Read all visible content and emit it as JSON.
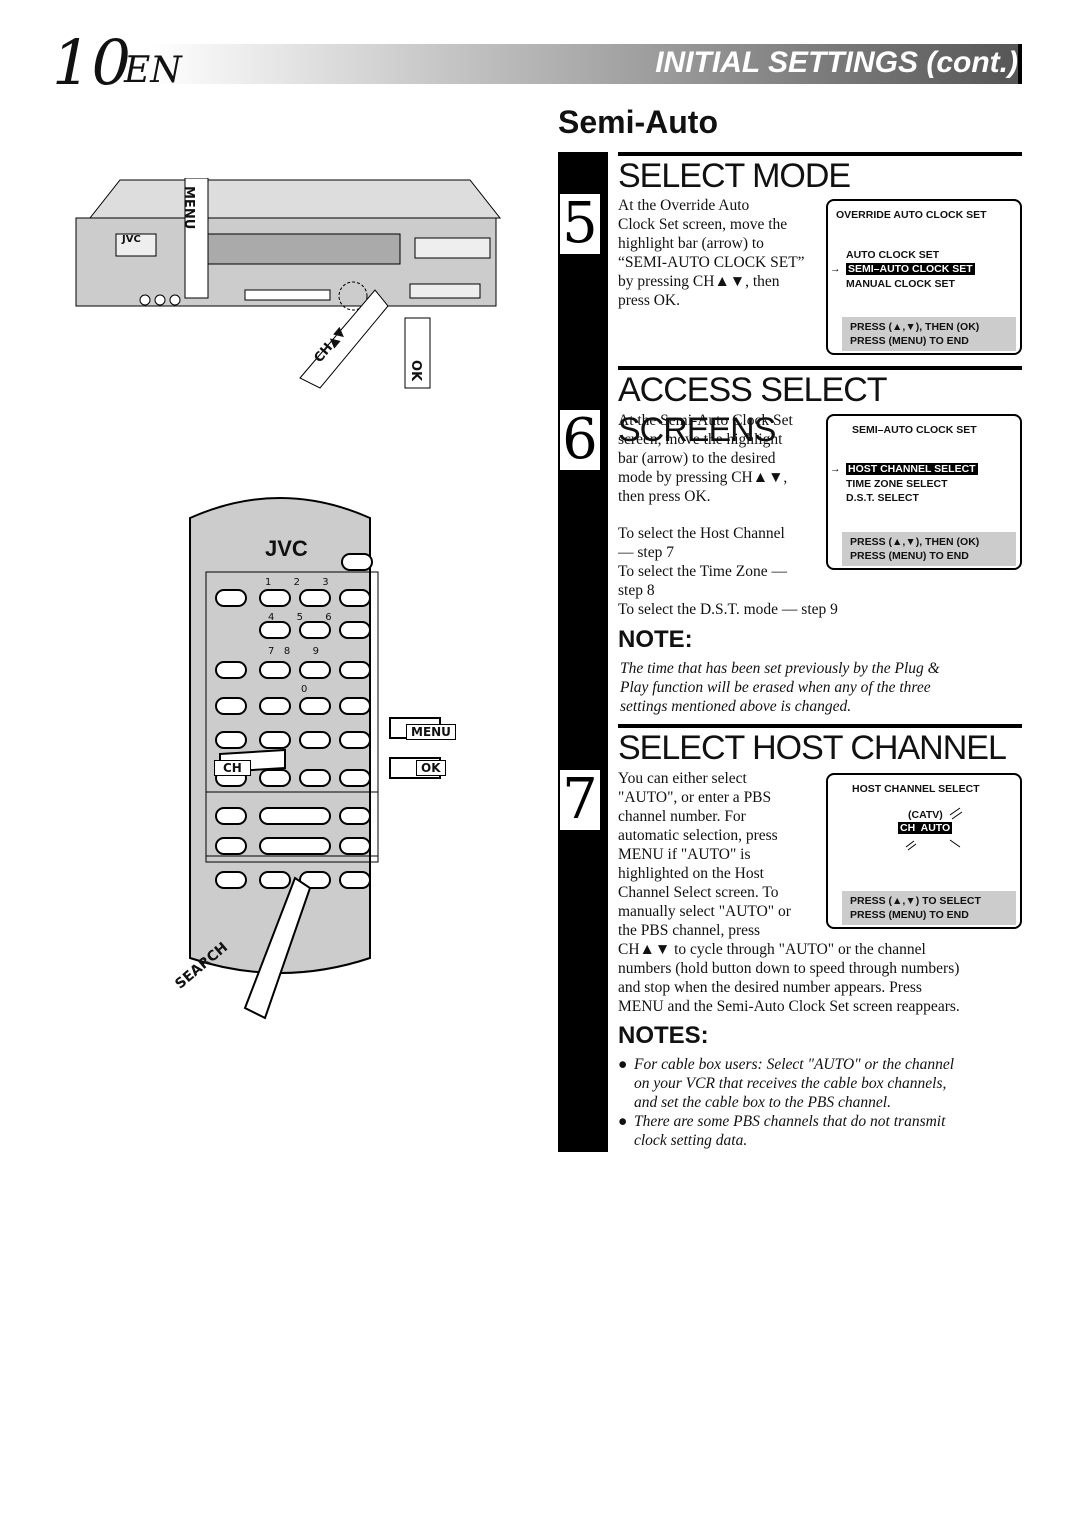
{
  "header": {
    "page_number": "10",
    "lang": "EN",
    "title": "INITIAL SETTINGS (cont.)"
  },
  "section": "Semi-Auto",
  "illustration": {
    "vcr_brand": "JVC",
    "menu_label": "MENU",
    "ch_label": "CH▲▼",
    "ok_label": "OK",
    "remote_brand": "JVC",
    "keys": [
      "1",
      "2",
      "3",
      "4",
      "5",
      "6",
      "7",
      "8",
      "9",
      "0"
    ],
    "remote_menu": "MENU",
    "remote_ch": "CH",
    "remote_ok": "OK",
    "search": "SEARCH"
  },
  "steps": [
    {
      "num": "5",
      "title": "SELECT MODE",
      "text": [
        "At the Override Auto",
        "Clock Set screen, move the",
        "highlight bar (arrow) to",
        "“SEMI-AUTO CLOCK SET”",
        "by pressing CH▲▼, then",
        "press OK."
      ],
      "osd": {
        "title": "OVERRIDE AUTO CLOCK SET",
        "items": [
          "AUTO CLOCK SET",
          "SEMI–AUTO CLOCK SET",
          "MANUAL CLOCK SET"
        ],
        "selected": 1,
        "press1": "PRESS (▲,▼), THEN (OK)",
        "press2": "PRESS (MENU) TO END"
      }
    },
    {
      "num": "6",
      "title": "ACCESS SELECT SCREENS",
      "text": [
        "At the Semi-Auto Clock Set",
        "screen, move the highlight",
        "bar (arrow) to the desired",
        "mode by pressing CH▲▼,",
        "then press OK."
      ],
      "text2": [
        "To select the Host Channel",
        "— step 7",
        "To select the Time Zone —",
        "step 8",
        "To select the D.S.T. mode — step 9"
      ],
      "osd": {
        "title": "SEMI–AUTO CLOCK SET",
        "items": [
          "HOST CHANNEL SELECT",
          "TIME ZONE SELECT",
          "D.S.T. SELECT"
        ],
        "selected": 0,
        "press1": "PRESS (▲,▼), THEN (OK)",
        "press2": "PRESS (MENU) TO END"
      }
    },
    {
      "num": "7",
      "title": "SELECT HOST CHANNEL",
      "text": [
        "You can either select",
        "\"AUTO\", or enter a PBS",
        "channel number. For",
        "automatic selection, press",
        "MENU if \"AUTO\" is",
        "highlighted on the Host",
        "Channel Select screen. To",
        "manually select \"AUTO\" or",
        "the PBS channel, press"
      ],
      "text_wide": [
        "CH▲▼ to cycle through \"AUTO\" or the channel",
        "numbers (hold button down to speed through numbers)",
        "and stop when the desired number appears. Press",
        "MENU and the Semi-Auto Clock Set screen reappears."
      ],
      "osd": {
        "title": "HOST CHANNEL SELECT",
        "catv": "(CATV)",
        "ch": "CH  AUTO",
        "press1": "PRESS (▲,▼) TO SELECT",
        "press2": "PRESS (MENU) TO END"
      }
    }
  ],
  "note": {
    "heading": "NOTE:",
    "lines": [
      "The time that has been set previously by the Plug &",
      "Play function will be erased when any of the three",
      "settings mentioned above is changed."
    ]
  },
  "notes": {
    "heading": "NOTES:",
    "items": [
      [
        "For cable box users:  Select \"AUTO\" or the channel",
        "on your VCR that receives the cable box channels,",
        "and set the cable box to the PBS channel."
      ],
      [
        "There are some PBS channels that do not transmit",
        "clock setting data."
      ]
    ]
  }
}
